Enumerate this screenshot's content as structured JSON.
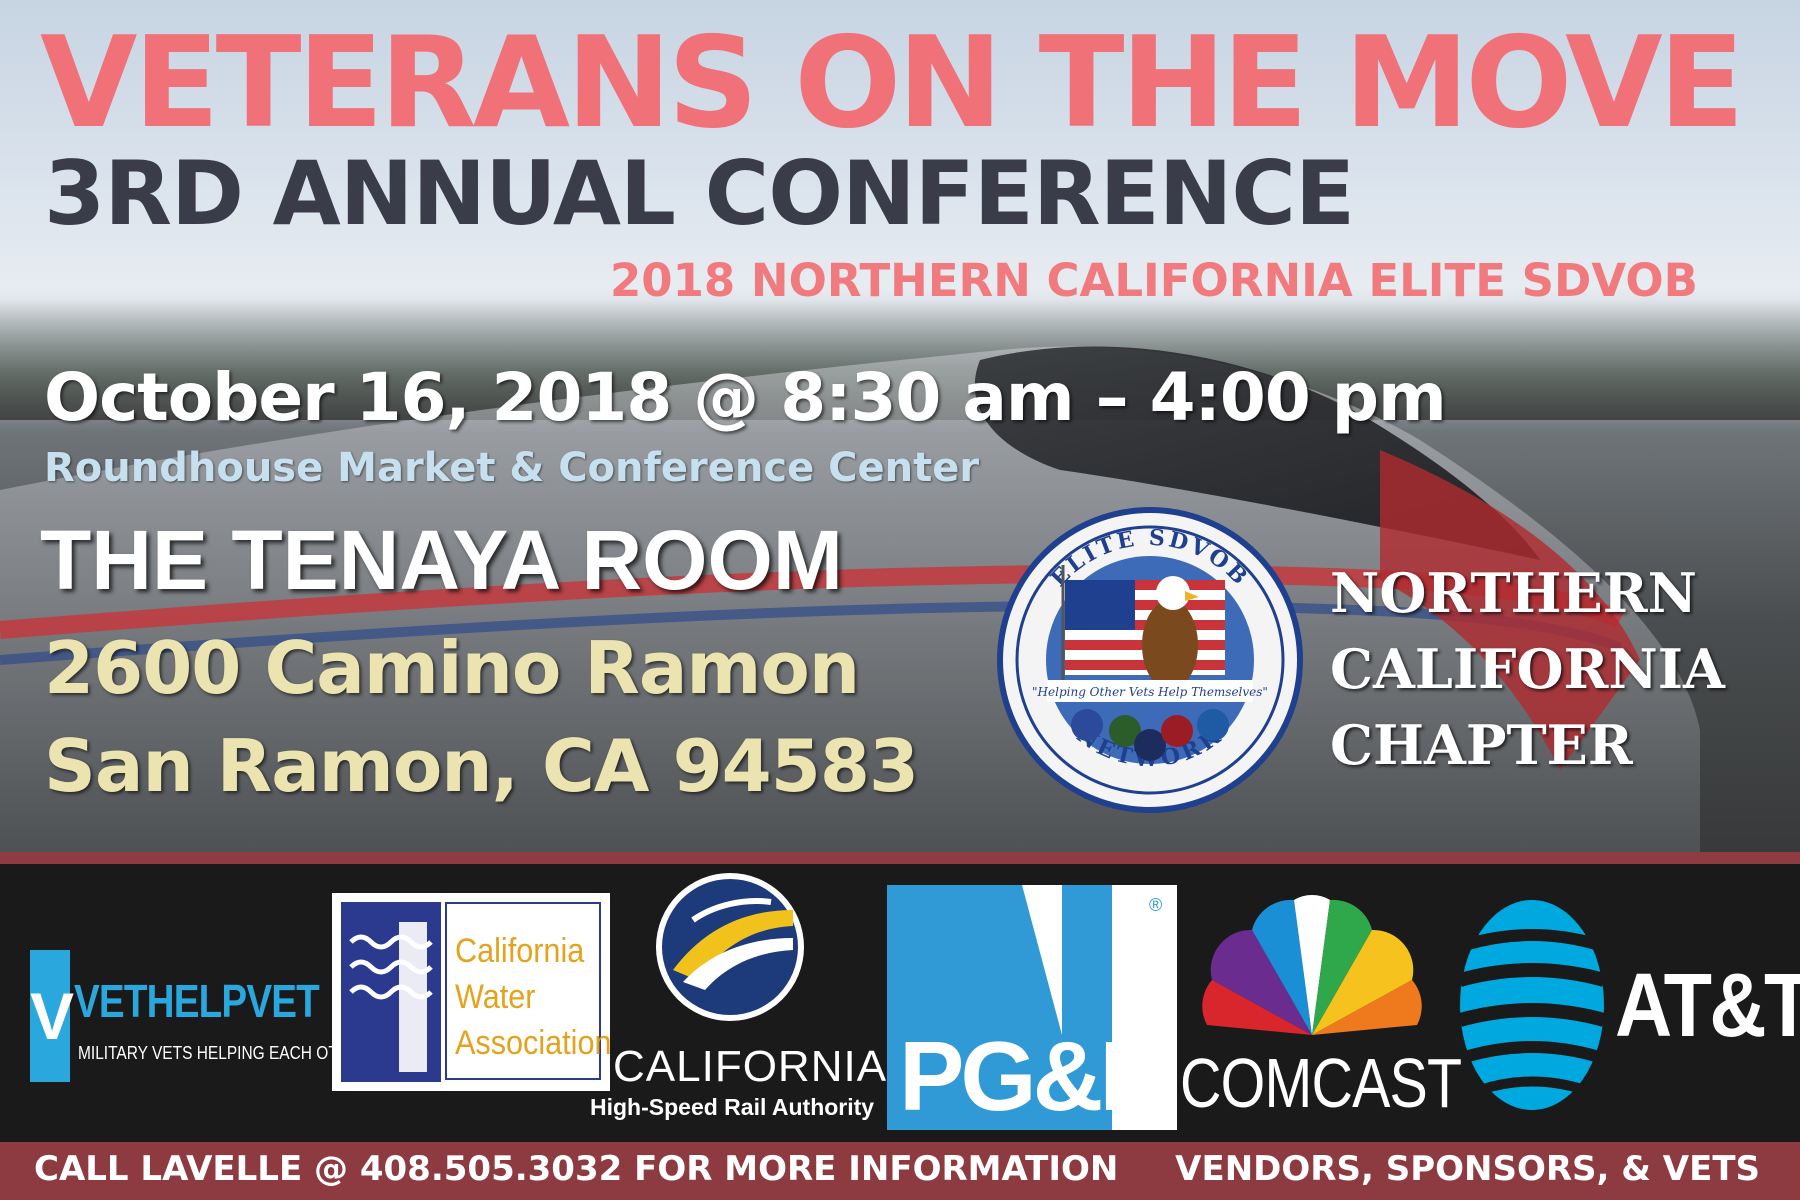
{
  "header": {
    "title": "VETERANS ON THE MOVE",
    "subtitle": "3RD ANNUAL CONFERENCE",
    "tagline": "2018 NORTHERN CALIFORNIA ELITE SDVOB"
  },
  "event": {
    "date_time": "October 16, 2018 @ 8:30 am – 4:00 pm",
    "venue": "Roundhouse Market & Conference Center",
    "room": "THE TENAYA ROOM",
    "address_line1": "2600 Camino Ramon",
    "address_line2": "San Ramon, CA 94583"
  },
  "chapter": {
    "lines": [
      "NORTHERN",
      "CALIFORNIA",
      "CHAPTER"
    ]
  },
  "seal": {
    "top_text": "ELITE SDVOB",
    "bottom_text": "NETWORK",
    "motto": "\"Helping  Other Vets Help Themselves\""
  },
  "sponsors": {
    "vethelpvet": {
      "initial": "V",
      "name": "VETHELPVET",
      "tagline": "MILITARY VETS HELPING EACH OTHER",
      "color": "#2aa7dd"
    },
    "cwa": {
      "lines": [
        "California",
        "Water",
        "Association"
      ],
      "color": "#e5a21c",
      "mark_color": "#2b3a8f"
    },
    "hsr": {
      "name": "CALIFORNIA",
      "sub": "High-Speed Rail Authority"
    },
    "pge": {
      "name": "PG&E",
      "reg": "®"
    },
    "comcast": {
      "name": "COMCAST"
    },
    "att": {
      "name": "AT&T",
      "color": "#00a8e0"
    }
  },
  "footer": {
    "left": "CALL LAVELLE @ 408.505.3032 FOR MORE INFORMATION",
    "right": "VENDORS, SPONSORS, & VETS"
  },
  "colors": {
    "accent_red": "#f07278",
    "footer_bar": "#8d3b40",
    "title_dark": "#3a3c4a",
    "address_cream": "#ece4b0"
  }
}
